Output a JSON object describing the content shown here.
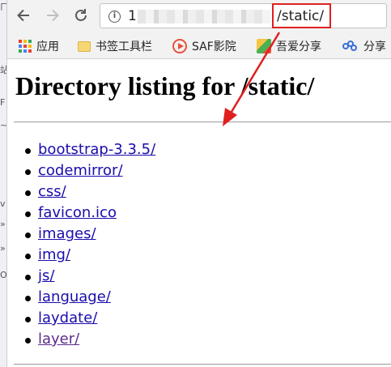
{
  "browser": {
    "url_host": "1",
    "url_path": "/static/",
    "back_icon": "arrow-left-icon",
    "forward_icon": "arrow-right-icon",
    "reload_icon": "reload-icon"
  },
  "bookmarks": [
    {
      "label": "应用",
      "icon": "apps-grid-icon"
    },
    {
      "label": "书签工具栏",
      "icon": "folder-icon"
    },
    {
      "label": "SAF影院",
      "icon": "play-circle-icon"
    },
    {
      "label": "吾爱分享",
      "icon": "site-favicon-icon"
    },
    {
      "label": "分享",
      "icon": "share-icon"
    }
  ],
  "page": {
    "title": "Directory listing for /static/",
    "entries": [
      {
        "name": "bootstrap-3.3.5/",
        "visited": false
      },
      {
        "name": "codemirror/",
        "visited": false
      },
      {
        "name": "css/",
        "visited": false
      },
      {
        "name": "favicon.ico",
        "visited": false
      },
      {
        "name": "images/",
        "visited": false
      },
      {
        "name": "img/",
        "visited": false
      },
      {
        "name": "js/",
        "visited": false
      },
      {
        "name": "language/",
        "visited": false
      },
      {
        "name": "laydate/",
        "visited": false
      },
      {
        "name": "layer/",
        "visited": true
      }
    ]
  },
  "colors": {
    "link": "#1a0dab",
    "visited_link": "#5e2b8a",
    "annotation": "#e02020"
  }
}
